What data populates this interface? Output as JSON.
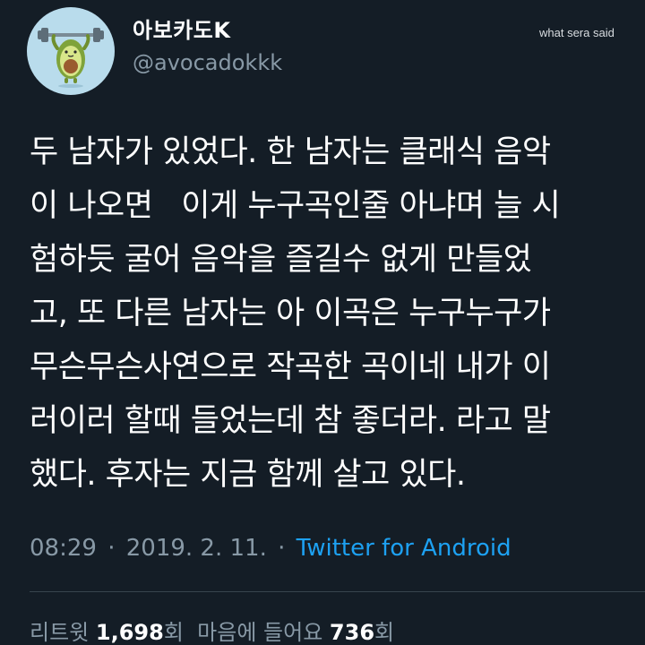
{
  "author": {
    "display_name": "아보카도K",
    "handle": "@avocadokkk",
    "avatar_icon": "avocado-mascot-icon",
    "avatar_bg": "#b9dcec"
  },
  "watermark": "what sera said",
  "tweet": {
    "lines": [
      "두 남자가 있었다. 한 남자는 클래식 음악",
      "이 나오면   이게 누구곡인줄 아냐며 늘 시",
      "험하듯 굴어 음악을 즐길수 없게 만들었",
      "고, 또 다른 남자는 아 이곡은 누구누구가",
      "무슨무슨사연으로 작곡한 곡이네 내가 이",
      "러이러 할때 들었는데 참 좋더라. 라고 말",
      "했다. 후자는 지금 함께 살고 있다."
    ]
  },
  "meta": {
    "time": "08:29",
    "separator": "·",
    "date": "2019. 2. 11.",
    "source": "Twitter for Android"
  },
  "stats": {
    "retweets_label": "리트윗",
    "retweets_count": "1,698",
    "retweets_unit": "회",
    "likes_label": "마음에 들어요",
    "likes_count": "736",
    "likes_unit": "회"
  },
  "colors": {
    "background": "#141d26",
    "primary_text": "#ffffff",
    "secondary_text": "#8899a6",
    "link": "#1da1f2",
    "divider": "#38444d"
  }
}
